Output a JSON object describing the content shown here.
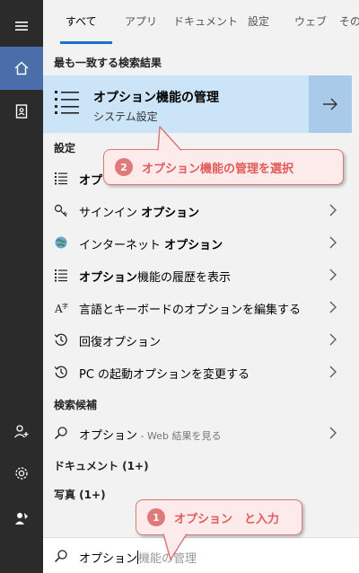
{
  "tabs": [
    {
      "label": "すべて",
      "active": true
    },
    {
      "label": "アプリ"
    },
    {
      "label": "ドキュメント"
    },
    {
      "label": "設定"
    },
    {
      "label": "ウェブ"
    },
    {
      "label": "その"
    }
  ],
  "best_match": {
    "heading": "最も一致する検索結果",
    "title": "オプション機能の管理",
    "subtitle": "システム設定",
    "icon": "list-icon"
  },
  "settings": {
    "heading": "設定",
    "items": [
      {
        "icon": "list-icon",
        "parts": [
          {
            "t": "オプ",
            "b": true
          }
        ]
      },
      {
        "icon": "key-icon",
        "parts": [
          {
            "t": "サインイン "
          },
          {
            "t": "オプション",
            "b": true
          }
        ]
      },
      {
        "icon": "globe-icon",
        "parts": [
          {
            "t": "インターネット "
          },
          {
            "t": "オプション",
            "b": true
          }
        ]
      },
      {
        "icon": "list-icon",
        "parts": [
          {
            "t": "オプション",
            "b": true
          },
          {
            "t": "機能の履歴を表示"
          }
        ]
      },
      {
        "icon": "language-icon",
        "parts": [
          {
            "t": "言語とキーボードのオプションを編集する"
          }
        ]
      },
      {
        "icon": "history-icon",
        "parts": [
          {
            "t": "回復オプション"
          }
        ]
      },
      {
        "icon": "history-icon",
        "parts": [
          {
            "t": "PC の起動オプションを変更する"
          }
        ]
      }
    ]
  },
  "suggestions": {
    "heading": "検索候補",
    "item_text": "オプション",
    "item_note": " - Web 結果を見る"
  },
  "documents_heading": "ドキュメント (1+)",
  "photos_heading": "写真 (1+)",
  "search": {
    "typed": "オプション",
    "suggestion": "機能の管理"
  },
  "callouts": [
    {
      "number": "2",
      "text": "オプション機能の管理を選択"
    },
    {
      "number": "1",
      "text": "オプション　と入力"
    }
  ],
  "colors": {
    "accent": "#1a73c8",
    "rail": "#2b2b2b",
    "rail_active": "#4a6ea9",
    "best_match_bg": "#cce4f7",
    "callout_text": "#e25b58"
  }
}
